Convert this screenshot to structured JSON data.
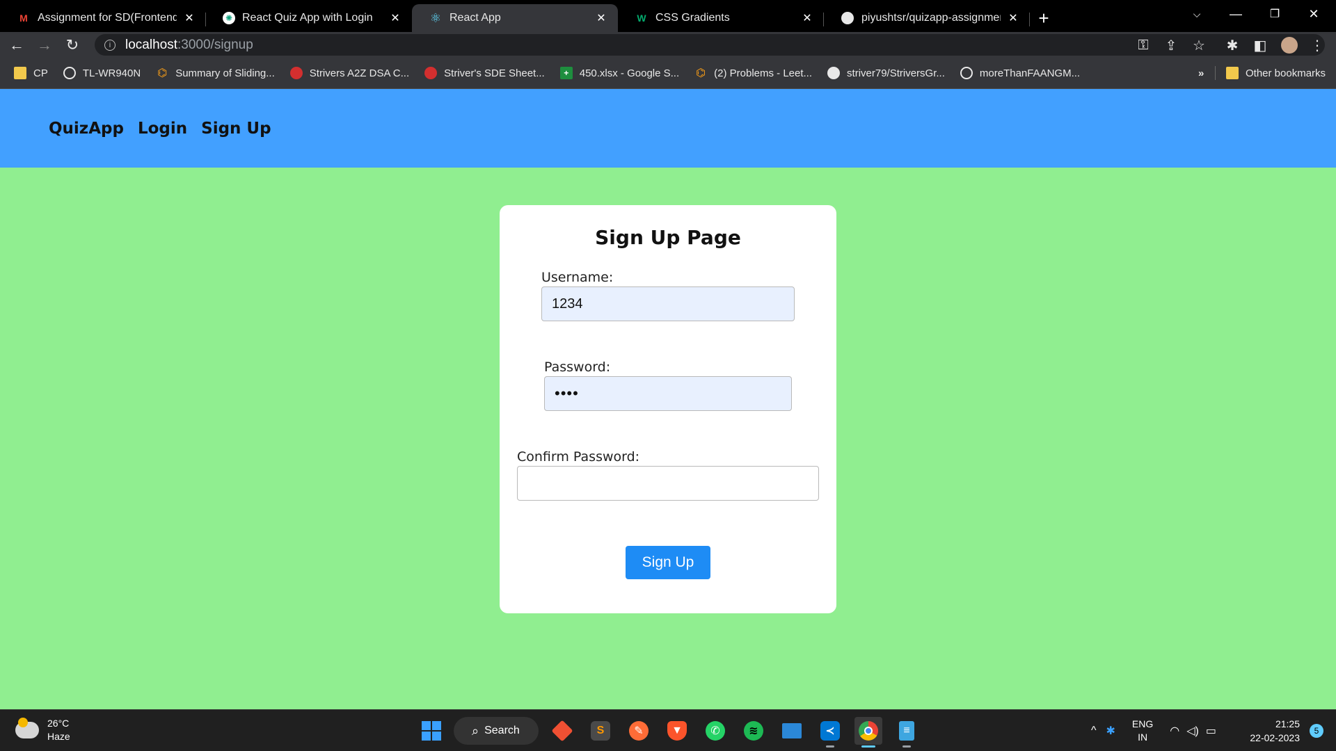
{
  "browser": {
    "tabs": [
      {
        "title": "Assignment for SD(Frontend) Inte",
        "icon": "gmail-icon",
        "active": false
      },
      {
        "title": "React Quiz App with Login",
        "icon": "chatgpt-icon",
        "active": false
      },
      {
        "title": "React App",
        "icon": "react-icon",
        "active": true
      },
      {
        "title": "CSS Gradients",
        "icon": "w3schools-icon",
        "active": false
      },
      {
        "title": "piyushtsr/quizapp-assignment",
        "icon": "github-icon",
        "active": false
      }
    ],
    "url_host": "localhost",
    "url_path": ":3000/signup",
    "bookmarks": [
      {
        "label": "CP",
        "icon": "folder-icon"
      },
      {
        "label": "TL-WR940N",
        "icon": "globe-icon"
      },
      {
        "label": "Summary of Sliding...",
        "icon": "leetcode-icon"
      },
      {
        "label": "Strivers A2Z DSA C...",
        "icon": "tuf-icon"
      },
      {
        "label": "Striver's SDE Sheet...",
        "icon": "tuf-icon"
      },
      {
        "label": "450.xlsx - Google S...",
        "icon": "google-sheets-icon"
      },
      {
        "label": "(2) Problems - Leet...",
        "icon": "leetcode-icon"
      },
      {
        "label": "striver79/StriversGr...",
        "icon": "github-icon"
      },
      {
        "label": "moreThanFAANGM...",
        "icon": "globe-icon"
      }
    ],
    "bookmarks_overflow": "»",
    "other_bookmarks": "Other bookmarks"
  },
  "app": {
    "nav": [
      "QuizApp",
      "Login",
      "Sign Up"
    ],
    "heading": "Sign Up Page",
    "username_label": "Username:",
    "username_value": "1234",
    "password_label": "Password:",
    "password_value": "••••",
    "confirm_label": "Confirm Password:",
    "confirm_value": "",
    "submit_label": "Sign Up"
  },
  "colors": {
    "page_bg": "#90ee90",
    "header_bg": "#42a0ff",
    "button_bg": "#1e8cf5",
    "autofill_bg": "#e8f0fe"
  },
  "taskbar": {
    "temperature": "26°C",
    "weather": "Haze",
    "search_label": "Search",
    "language": "ENG",
    "region": "IN",
    "time": "21:25",
    "date": "22-02-2023",
    "notification_count": "5"
  }
}
